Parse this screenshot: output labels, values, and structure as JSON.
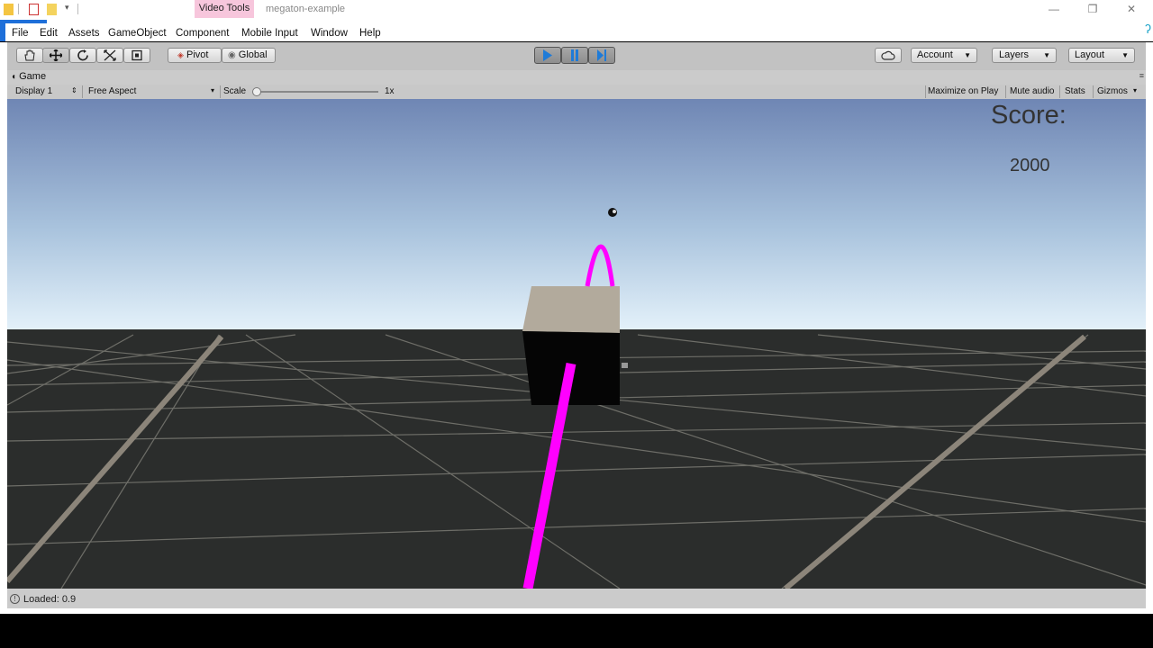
{
  "titlebar": {
    "ribbon_tab": "Video Tools",
    "document_title": "megaton-example"
  },
  "menu": [
    "File",
    "Edit",
    "Assets",
    "GameObject",
    "Component",
    "Mobile Input",
    "Window",
    "Help"
  ],
  "toolbar": {
    "pivot_label": "Pivot",
    "global_label": "Global",
    "account_label": "Account",
    "layers_label": "Layers",
    "layout_label": "Layout"
  },
  "game_view": {
    "tab_label": "Game",
    "display": "Display 1",
    "aspect": "Free Aspect",
    "scale_label": "Scale",
    "scale_value": "1x",
    "maximize_on_play": "Maximize on Play",
    "mute_audio": "Mute audio",
    "stats": "Stats",
    "gizmos": "Gizmos"
  },
  "game": {
    "score_label": "Score:",
    "score_value": "2000"
  },
  "status": {
    "text": "Loaded: 0.9"
  },
  "colors": {
    "laser": "#ff00ff",
    "sky_top": "#6f86b4",
    "sky_horizon": "#e6f3fb",
    "ground": "#2b2d2c",
    "play_active": "#1e7bd8"
  }
}
